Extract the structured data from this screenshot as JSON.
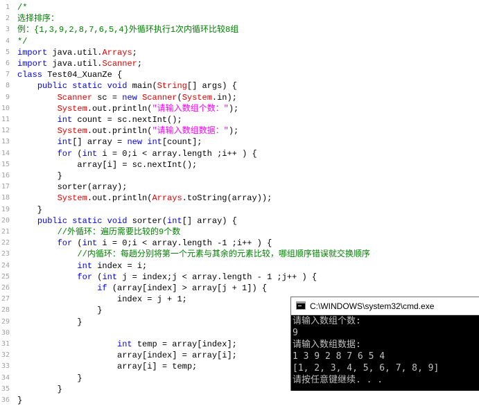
{
  "editor": {
    "lines": [
      {
        "n": "1",
        "parts": [
          {
            "t": "/*",
            "c": "cm"
          }
        ]
      },
      {
        "n": "2",
        "parts": [
          {
            "t": "选择排序：",
            "c": "cm"
          }
        ]
      },
      {
        "n": "3",
        "parts": [
          {
            "t": "例：{1,3,9,2,8,7,6,5,4}外循环执行1次内循环比较8组",
            "c": "cm"
          }
        ]
      },
      {
        "n": "4",
        "parts": [
          {
            "t": "*/",
            "c": "cm"
          }
        ]
      },
      {
        "n": "5",
        "parts": [
          {
            "t": "import",
            "c": "kw"
          },
          {
            "t": " java.util.",
            "c": ""
          },
          {
            "t": "Arrays",
            "c": "cls"
          },
          {
            "t": ";",
            "c": ""
          }
        ]
      },
      {
        "n": "6",
        "parts": [
          {
            "t": "import",
            "c": "kw"
          },
          {
            "t": " java.util.",
            "c": ""
          },
          {
            "t": "Scanner",
            "c": "cls"
          },
          {
            "t": ";",
            "c": ""
          }
        ]
      },
      {
        "n": "7",
        "parts": [
          {
            "t": "class",
            "c": "kw"
          },
          {
            "t": " Test04_XuanZe {",
            "c": ""
          }
        ]
      },
      {
        "n": "8",
        "parts": [
          {
            "t": "    ",
            "c": ""
          },
          {
            "t": "public static void",
            "c": "kw"
          },
          {
            "t": " main(",
            "c": ""
          },
          {
            "t": "String",
            "c": "cls"
          },
          {
            "t": "[] args) {",
            "c": ""
          }
        ]
      },
      {
        "n": "9",
        "parts": [
          {
            "t": "        ",
            "c": ""
          },
          {
            "t": "Scanner",
            "c": "cls"
          },
          {
            "t": " sc = ",
            "c": ""
          },
          {
            "t": "new",
            "c": "kw"
          },
          {
            "t": " ",
            "c": ""
          },
          {
            "t": "Scanner",
            "c": "cls"
          },
          {
            "t": "(",
            "c": ""
          },
          {
            "t": "System",
            "c": "cls"
          },
          {
            "t": ".in);",
            "c": ""
          }
        ]
      },
      {
        "n": "10",
        "parts": [
          {
            "t": "        ",
            "c": ""
          },
          {
            "t": "System",
            "c": "cls"
          },
          {
            "t": ".out.println(",
            "c": ""
          },
          {
            "t": "\"请输入数组个数：\"",
            "c": "str"
          },
          {
            "t": ");",
            "c": ""
          }
        ]
      },
      {
        "n": "11",
        "parts": [
          {
            "t": "        ",
            "c": ""
          },
          {
            "t": "int",
            "c": "kw"
          },
          {
            "t": " count = sc.nextInt();",
            "c": ""
          }
        ]
      },
      {
        "n": "12",
        "parts": [
          {
            "t": "        ",
            "c": ""
          },
          {
            "t": "System",
            "c": "cls"
          },
          {
            "t": ".out.println(",
            "c": ""
          },
          {
            "t": "\"请输入数组数据：\"",
            "c": "str"
          },
          {
            "t": ");",
            "c": ""
          }
        ]
      },
      {
        "n": "13",
        "parts": [
          {
            "t": "        ",
            "c": ""
          },
          {
            "t": "int",
            "c": "kw"
          },
          {
            "t": "[] array = ",
            "c": ""
          },
          {
            "t": "new",
            "c": "kw"
          },
          {
            "t": " ",
            "c": ""
          },
          {
            "t": "int",
            "c": "kw"
          },
          {
            "t": "[count];",
            "c": ""
          }
        ]
      },
      {
        "n": "14",
        "parts": [
          {
            "t": "        ",
            "c": ""
          },
          {
            "t": "for",
            "c": "kw"
          },
          {
            "t": " (",
            "c": ""
          },
          {
            "t": "int",
            "c": "kw"
          },
          {
            "t": " i = 0;i < array.length ;i++ ) {",
            "c": ""
          }
        ]
      },
      {
        "n": "15",
        "parts": [
          {
            "t": "            array[i] = sc.nextInt();",
            "c": ""
          }
        ]
      },
      {
        "n": "16",
        "parts": [
          {
            "t": "        }",
            "c": ""
          }
        ]
      },
      {
        "n": "17",
        "parts": [
          {
            "t": "        sorter(array);",
            "c": ""
          }
        ]
      },
      {
        "n": "18",
        "parts": [
          {
            "t": "        ",
            "c": ""
          },
          {
            "t": "System",
            "c": "cls"
          },
          {
            "t": ".out.println(",
            "c": ""
          },
          {
            "t": "Arrays",
            "c": "cls"
          },
          {
            "t": ".toString(array));",
            "c": ""
          }
        ]
      },
      {
        "n": "19",
        "parts": [
          {
            "t": "    }",
            "c": ""
          }
        ]
      },
      {
        "n": "20",
        "parts": [
          {
            "t": "    ",
            "c": ""
          },
          {
            "t": "public static void",
            "c": "kw"
          },
          {
            "t": " sorter(",
            "c": ""
          },
          {
            "t": "int",
            "c": "kw"
          },
          {
            "t": "[] array) {",
            "c": ""
          }
        ]
      },
      {
        "n": "21",
        "parts": [
          {
            "t": "        ",
            "c": ""
          },
          {
            "t": "//外循环：遍历需要比较的9个数",
            "c": "cm"
          }
        ]
      },
      {
        "n": "22",
        "parts": [
          {
            "t": "        ",
            "c": ""
          },
          {
            "t": "for",
            "c": "kw"
          },
          {
            "t": " (",
            "c": ""
          },
          {
            "t": "int",
            "c": "kw"
          },
          {
            "t": " i = 0;i < array.length -1 ;i++ ) {",
            "c": ""
          }
        ]
      },
      {
        "n": "23",
        "parts": [
          {
            "t": "            ",
            "c": ""
          },
          {
            "t": "//内循环：每趟分别将第一个元素与其余的元素比较，哪组顺序错误就交换顺序",
            "c": "cm"
          }
        ]
      },
      {
        "n": "24",
        "parts": [
          {
            "t": "            ",
            "c": ""
          },
          {
            "t": "int",
            "c": "kw"
          },
          {
            "t": " index = i;",
            "c": ""
          }
        ]
      },
      {
        "n": "25",
        "parts": [
          {
            "t": "            ",
            "c": ""
          },
          {
            "t": "for",
            "c": "kw"
          },
          {
            "t": " (",
            "c": ""
          },
          {
            "t": "int",
            "c": "kw"
          },
          {
            "t": " j = index;j < array.length - 1 ;j++ ) {",
            "c": ""
          }
        ]
      },
      {
        "n": "26",
        "parts": [
          {
            "t": "                ",
            "c": ""
          },
          {
            "t": "if",
            "c": "kw"
          },
          {
            "t": " (array[index] > array[j + 1]) {",
            "c": ""
          }
        ]
      },
      {
        "n": "27",
        "parts": [
          {
            "t": "                    index = j + 1;",
            "c": ""
          }
        ]
      },
      {
        "n": "28",
        "parts": [
          {
            "t": "                }",
            "c": ""
          }
        ]
      },
      {
        "n": "29",
        "parts": [
          {
            "t": "            }",
            "c": ""
          }
        ]
      },
      {
        "n": "30",
        "parts": [
          {
            "t": "",
            "c": ""
          }
        ]
      },
      {
        "n": "31",
        "parts": [
          {
            "t": "                    ",
            "c": ""
          },
          {
            "t": "int",
            "c": "kw"
          },
          {
            "t": " temp = array[index];",
            "c": ""
          }
        ]
      },
      {
        "n": "32",
        "parts": [
          {
            "t": "                    array[index] = array[i];",
            "c": ""
          }
        ]
      },
      {
        "n": "33",
        "parts": [
          {
            "t": "                    array[i] = temp;",
            "c": ""
          }
        ]
      },
      {
        "n": "34",
        "parts": [
          {
            "t": "            }",
            "c": ""
          }
        ]
      },
      {
        "n": "35",
        "parts": [
          {
            "t": "        }",
            "c": ""
          }
        ]
      },
      {
        "n": "36",
        "parts": [
          {
            "t": "}",
            "c": ""
          }
        ]
      }
    ]
  },
  "cmd": {
    "title": "C:\\WINDOWS\\system32\\cmd.exe",
    "lines": [
      "请输入数组个数:",
      "9",
      "请输入数组数据:",
      "1 3 9 2 8 7 6 5 4",
      "[1, 2, 3, 4, 5, 6, 7, 8, 9]",
      "请按任意键继续. . ."
    ]
  },
  "colors": {
    "keyword": "#0000ff",
    "class_name": "#e60000",
    "string": "#ff00ff",
    "comment": "#008000",
    "line_number": "#a0a0a0",
    "console_bg": "#000000",
    "console_text": "#c0c0c0"
  },
  "icons": {
    "cmd_window": "console-icon"
  }
}
